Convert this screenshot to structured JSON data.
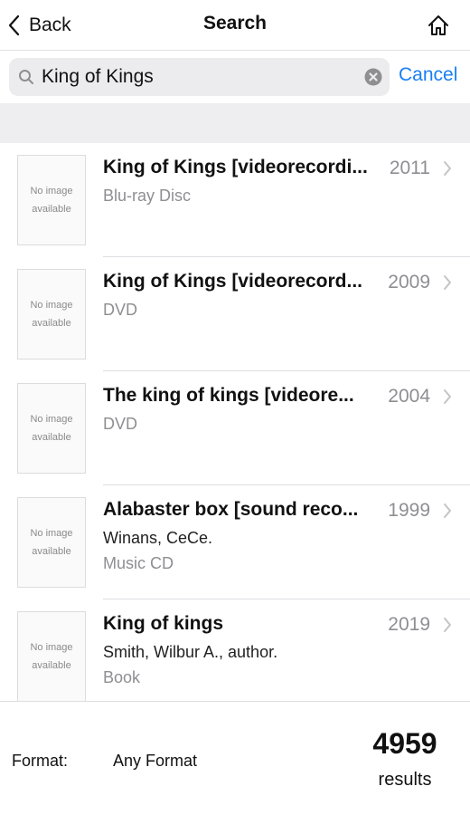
{
  "nav": {
    "back_label": "Back",
    "title": "Search"
  },
  "search": {
    "value": "King of Kings",
    "cancel_label": "Cancel"
  },
  "results": [
    {
      "thumb_line1": "No image",
      "thumb_line2": "available",
      "title": "King of Kings [videorecordi...",
      "year": "2011",
      "line2": "Blu-ray Disc",
      "line3": ""
    },
    {
      "thumb_line1": "No image",
      "thumb_line2": "available",
      "title": "King of Kings [videorecord...",
      "year": "2009",
      "line2": "DVD",
      "line3": ""
    },
    {
      "thumb_line1": "No image",
      "thumb_line2": "available",
      "title": "The king of kings [videore...",
      "year": "2004",
      "line2": "DVD",
      "line3": ""
    },
    {
      "thumb_line1": "No image",
      "thumb_line2": "available",
      "title": "Alabaster box [sound reco...",
      "year": "1999",
      "line2": "Winans, CeCe.",
      "line3": "Music CD"
    },
    {
      "thumb_line1": "No image",
      "thumb_line2": "available",
      "title": "King of kings",
      "year": "2019",
      "line2": "Smith, Wilbur A., author.",
      "line3": "Book"
    }
  ],
  "footer": {
    "format_label": "Format:",
    "format_value": "Any Format",
    "count": "4959",
    "count_label": "results"
  },
  "colors": {
    "accent": "#1a7ff5",
    "secondary_text": "#8e8e93"
  }
}
